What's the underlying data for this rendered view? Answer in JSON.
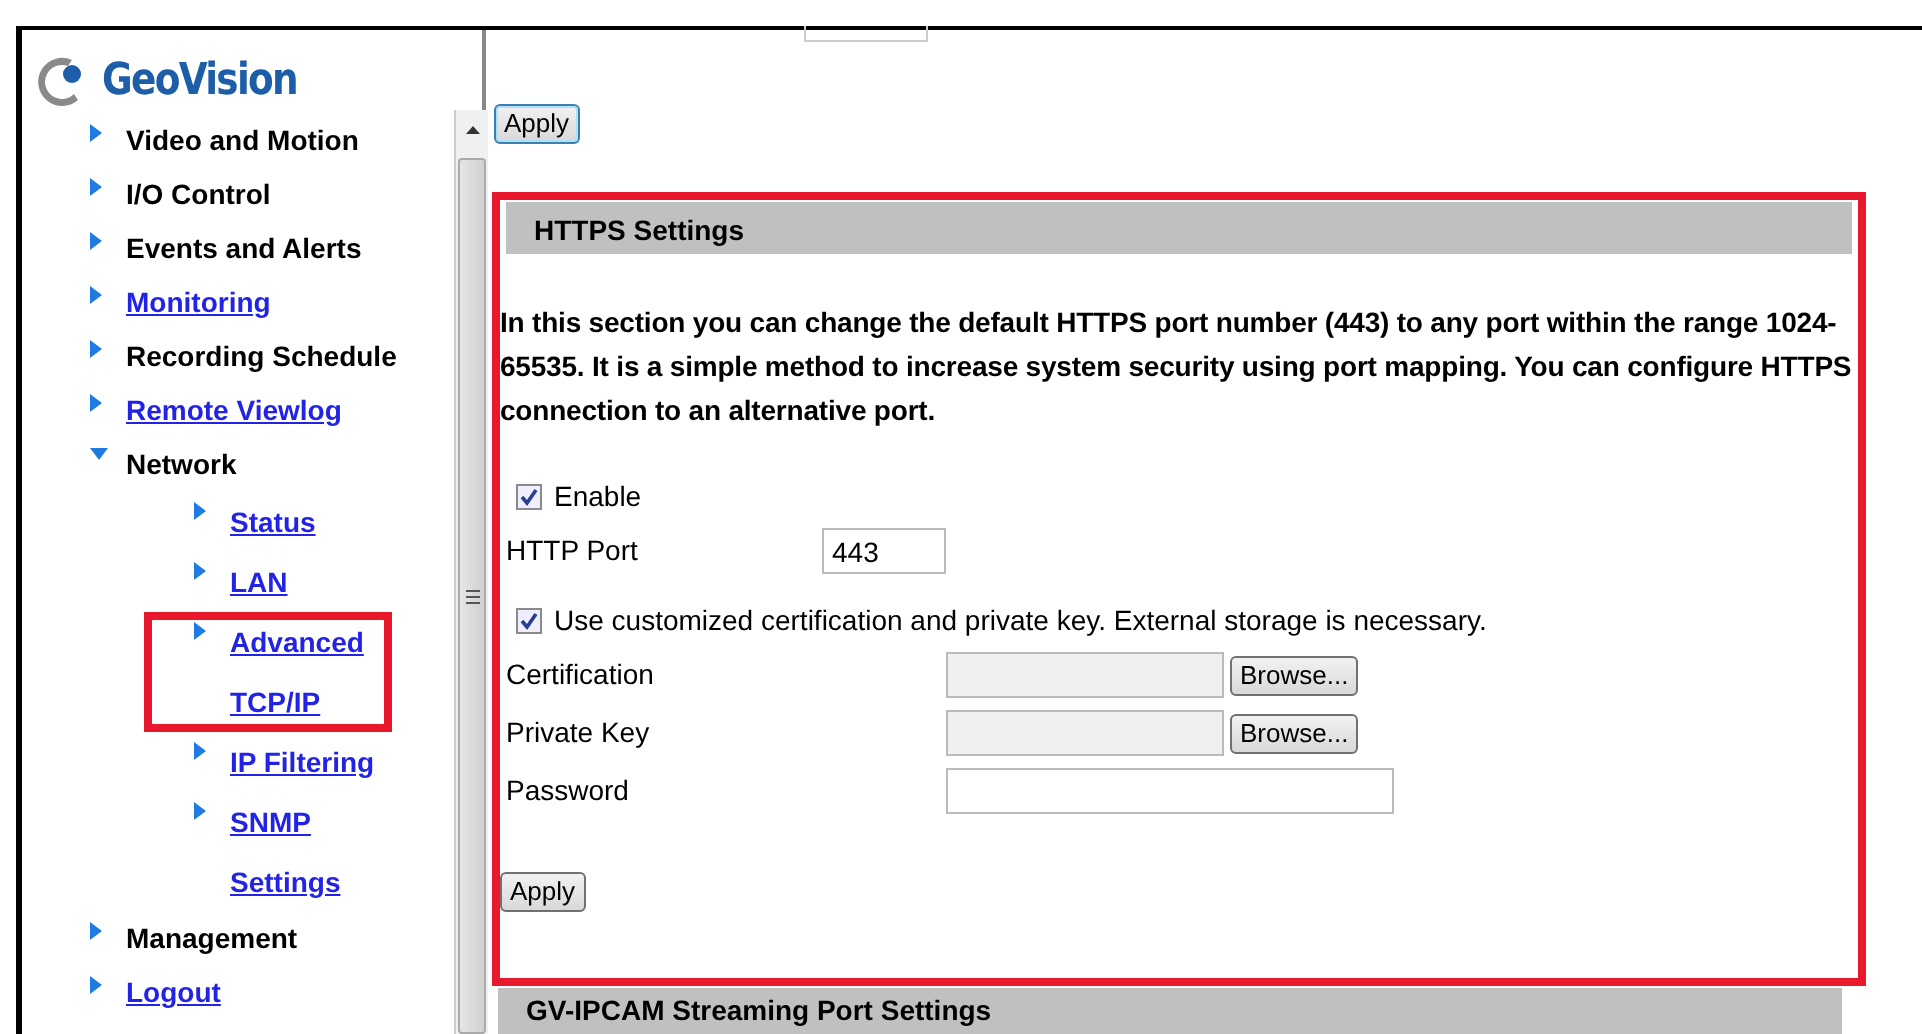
{
  "logo": {
    "text": "GeoVision"
  },
  "sidebar": {
    "items": [
      {
        "label": "Video and Motion",
        "kind": "text",
        "expanded": false
      },
      {
        "label": "I/O Control",
        "kind": "text",
        "expanded": false
      },
      {
        "label": "Events and Alerts",
        "kind": "text",
        "expanded": false
      },
      {
        "label": "Monitoring",
        "kind": "link",
        "expanded": false
      },
      {
        "label": "Recording Schedule",
        "kind": "text",
        "expanded": false
      },
      {
        "label": "Remote Viewlog",
        "kind": "link",
        "expanded": false
      },
      {
        "label": "Network",
        "kind": "text",
        "expanded": true,
        "children": [
          {
            "label": "Status",
            "kind": "link",
            "highlighted": false
          },
          {
            "label": "LAN",
            "kind": "link",
            "highlighted": false
          },
          {
            "label": "Advanced TCP/IP",
            "kind": "link",
            "highlighted": true
          },
          {
            "label": "IP Filtering",
            "kind": "link",
            "highlighted": false
          },
          {
            "label": "SNMP Settings",
            "kind": "link",
            "highlighted": false
          }
        ]
      },
      {
        "label": "Management",
        "kind": "text",
        "expanded": false
      },
      {
        "label": "Logout",
        "kind": "link",
        "expanded": false
      }
    ]
  },
  "top_apply": "Apply",
  "https": {
    "title": "HTTPS Settings",
    "highlighted": true,
    "description": "In this section you can change the default HTTPS port number (443) to any port within the range 1024-65535. It is a simple method to increase system security using port mapping. You can configure HTTPS connection to an alternative port.",
    "enable": {
      "label": "Enable",
      "checked": true
    },
    "port": {
      "label": "HTTP Port",
      "value": "443"
    },
    "custom": {
      "label": "Use customized certification and private key. External storage is necessary.",
      "checked": true
    },
    "files": [
      {
        "label": "Certification",
        "button": "Browse..."
      },
      {
        "label": "Private Key",
        "button": "Browse..."
      }
    ],
    "password": {
      "label": "Password"
    },
    "apply": "Apply"
  },
  "next_section": {
    "title": "GV-IPCAM Streaming Port Settings"
  }
}
